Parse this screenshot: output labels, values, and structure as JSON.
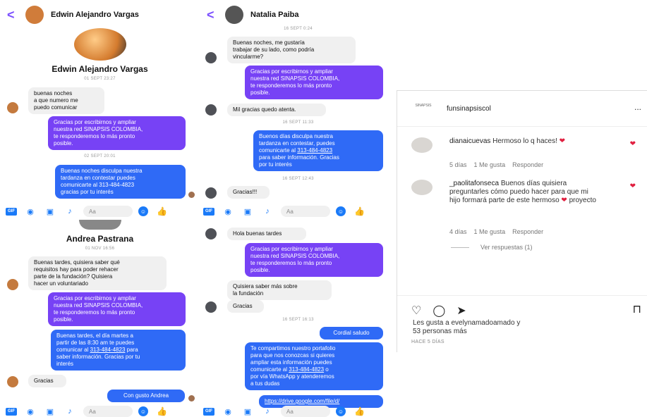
{
  "panel1": {
    "back": "<",
    "name": "Edwin Alejandro Vargas",
    "profile_name": "Edwin Alejandro Vargas",
    "ts1": "01 SEPT 23:27",
    "m1": "buenas noches\na que numero me\npuedo comunicar",
    "m2": "Gracias por escribirnos y ampliar\nnuestra red SINAPSIS COLOMBIA,\nte responderemos lo más pronto\nposible.",
    "ts2": "02 SEPT 20:01",
    "m3": "Buenas noches disculpa nuestra\ntardanza en contestar puedes\ncomunicarte al 313-484-4823\ngracias por tu interés"
  },
  "panel2": {
    "back": "<",
    "name": "Natalia Paiba",
    "ts1": "16 SEPT 0:24",
    "m1": "Buenas noches, me gustaría\ntrabajar de su lado, como podría\nvincularme?",
    "m2": "Gracias por escribirnos y ampliar\nnuestra red SINAPSIS COLOMBIA,\nte responderemos lo más pronto\nposible.",
    "m3": "Mil gracias quedo atenta.",
    "ts2": "16 SEPT 11:33",
    "m4a": "Buenos días disculpa nuestra\ntardanza en contestar, puedes\ncomunicarte al ",
    "m4phone": "313-484-4823",
    "m4b": "\npara saber información. Gracias\npor tu interés",
    "ts3": "16 SEPT 12:43",
    "m5": "Gracias!!!"
  },
  "panel3": {
    "name": "Andrea Pastrana",
    "ts1": "01 NOV 16:56",
    "m1": "Buenas tardes, quisiera saber qué\nrequisitos hay para poder rehacer\nparte de la fundación? Quisiera\nhacer un voluntariado",
    "m2": "Gracias por escribirnos y ampliar\nnuestra red SINAPSIS COLOMBIA,\nte responderemos lo más pronto\nposible.",
    "m3a": "Buenas tardes, el día martes a\npartir de las 8:30 am te puedes\ncomunicar al ",
    "m3phone": "313-484-4823",
    "m3b": " para\nsaber información. Gracias por tu\ninterés",
    "m4": "Gracias",
    "m5": "Con gusto Andrea"
  },
  "panel4": {
    "m1": "Hola buenas tardes",
    "m2": "Gracias por escribirnos y ampliar\nnuestra red SINAPSIS COLOMBIA,\nte responderemos lo más pronto\nposible.",
    "m3": "Quisiera saber más sobre\nla fundación",
    "m4": "Gracias",
    "ts1": "16 SEPT 16:13",
    "m5": "Cordial saludo",
    "m6a": "Te compartimos nuestro portafolio\npara que nos conozcas si quieres\nampliar esta información puedes\ncomunicarte al ",
    "m6phone": "313-484-4823",
    "m6b": " o\npor vía WhatsApp y atenderemos\na tus dudas",
    "m7": "https://drive.google.com/file/d/"
  },
  "composer": {
    "gif": "GIF",
    "placeholder": "Aa"
  },
  "icons": [
    "back-icon",
    "camera-icon",
    "image-icon",
    "mic-icon",
    "emoji-icon",
    "like-icon",
    "heart-icon",
    "comment-icon",
    "share-icon",
    "bookmark-icon",
    "more-icon"
  ],
  "instagram": {
    "account": "funsinapsiscol",
    "logo_text": "SINAPSIS",
    "more": "...",
    "c1": {
      "user": "dianaicuevas",
      "text": " Hermoso lo q haces!",
      "age": "5 días",
      "likes": "1 Me gusta",
      "reply": "Responder"
    },
    "c2": {
      "user": "_paolitafonseca",
      "text": " Buenos días quisiera preguntarles cómo puedo hacer para que mi hijo formará parte de este hermoso",
      "text2": " proyecto",
      "age": "4 días",
      "likes": "1 Me gusta",
      "reply": "Responder"
    },
    "see_replies": "Ver respuestas (1)",
    "likes_line1": "Les gusta a evelynamadoamado y",
    "likes_line2": "53 personas más",
    "ago": "HACE 5 DÍAS"
  },
  "colors": {
    "accent": "#7b4fff",
    "messenger_blue": "#1a7af8",
    "heart": "#e02040"
  }
}
